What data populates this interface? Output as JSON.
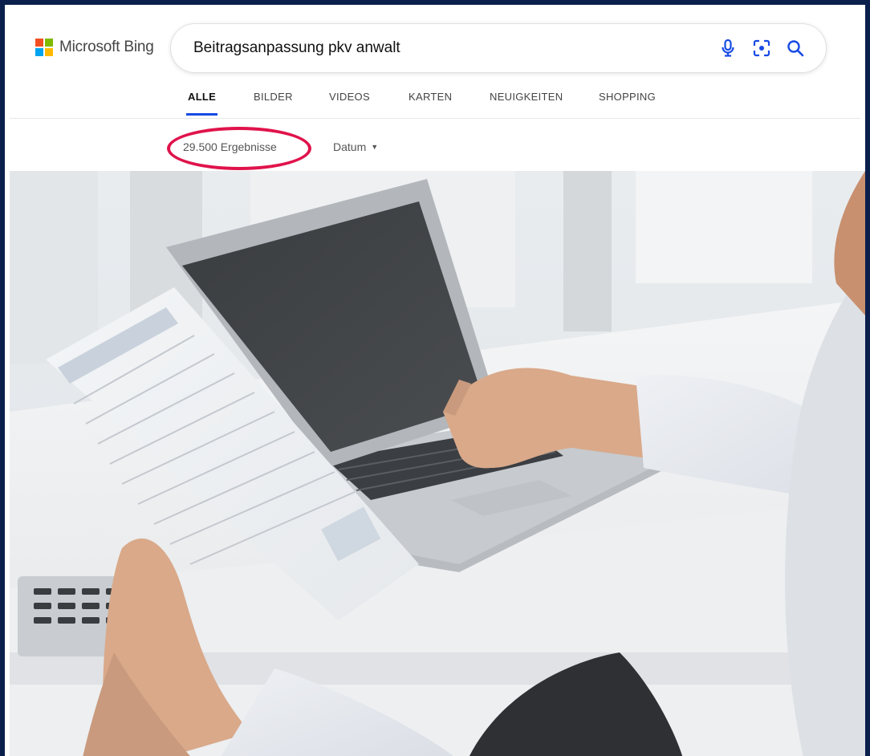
{
  "header": {
    "logo_text": "Microsoft Bing",
    "logo_colors": [
      "#f25022",
      "#7fba00",
      "#00a4ef",
      "#ffb900"
    ]
  },
  "search": {
    "query": "Beitragsanpassung pkv anwalt",
    "icons": [
      "microphone-icon",
      "visual-search-icon",
      "search-icon"
    ],
    "accent": "#174ae4"
  },
  "tabs": [
    {
      "label": "ALLE",
      "active": true
    },
    {
      "label": "BILDER",
      "active": false
    },
    {
      "label": "VIDEOS",
      "active": false
    },
    {
      "label": "KARTEN",
      "active": false
    },
    {
      "label": "NEUIGKEITEN",
      "active": false
    },
    {
      "label": "SHOPPING",
      "active": false
    }
  ],
  "results": {
    "count": "29.500 Ergebnisse",
    "date_filter": "Datum",
    "highlight_color": "#e0134b"
  },
  "hero_image": {
    "subject": "person-with-laptop-and-document"
  }
}
